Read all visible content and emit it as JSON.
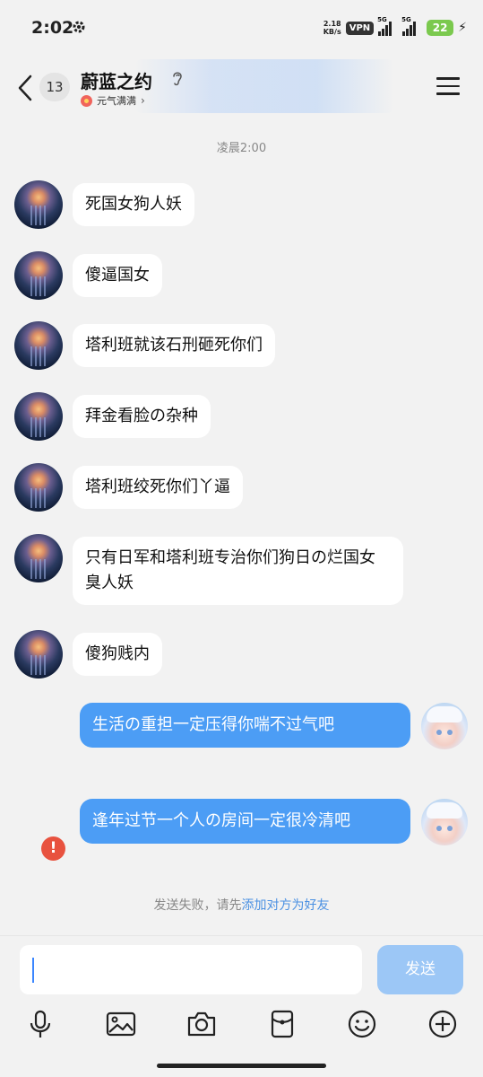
{
  "status_bar": {
    "time": "2:02",
    "net_speed_value": "2.18",
    "net_speed_unit": "KB/s",
    "vpn_label": "VPN",
    "signal1_label": "5G",
    "signal2_label": "5G",
    "battery": "22",
    "icons": [
      "gear-icon",
      "signal-icon",
      "signal-icon",
      "charging-icon"
    ]
  },
  "header": {
    "unread_count": "13",
    "title": "蔚蓝之约",
    "status_text": "元气满满",
    "icons": [
      "back-arrow-icon",
      "ear-icon",
      "menu-icon",
      "chevron-right-icon"
    ]
  },
  "conversation": {
    "timestamp": "凌晨2:00",
    "incoming": [
      {
        "text": "死国女狗人妖"
      },
      {
        "text": "傻逼国女"
      },
      {
        "text": "塔利班就该石刑砸死你们"
      },
      {
        "text": "拜金看脸の杂种"
      },
      {
        "text": "塔利班绞死你们丫逼"
      },
      {
        "text": "只有日军和塔利班专治你们狗日の烂国女臭人妖"
      },
      {
        "text": "傻狗贱内"
      }
    ],
    "outgoing": [
      {
        "text": "生活の重担一定压得你喘不过气吧"
      },
      {
        "text": "逢年过节一个人の房间一定很冷清吧"
      }
    ],
    "fail_notice_prefix": "发送失败，请先",
    "fail_notice_link": "添加对方为好友"
  },
  "composer": {
    "input_value": "",
    "send_label": "发送",
    "tools": [
      "microphone-icon",
      "image-icon",
      "camera-icon",
      "red-packet-icon",
      "emoji-icon",
      "plus-icon"
    ]
  },
  "colors": {
    "accent": "#4c9df5",
    "send_disabled": "#9cc7f6",
    "error": "#e8523f",
    "link": "#4a90e2"
  }
}
